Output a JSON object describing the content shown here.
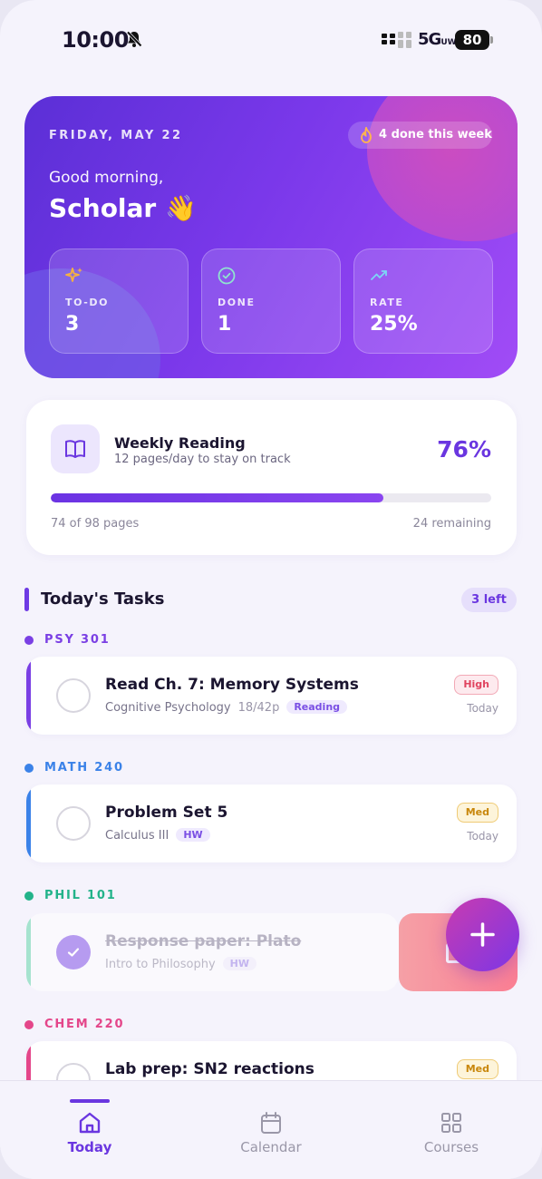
{
  "status": {
    "time": "10:00",
    "network": "5G",
    "network_sup": "UW",
    "battery": "80"
  },
  "hero": {
    "date": "FRIDAY, MAY 22",
    "streak": "4 done this week",
    "greeting": "Good morning,",
    "name": "Scholar 👋",
    "stats": [
      {
        "label": "TO-DO",
        "value": "3",
        "icon": "sparkles-icon",
        "color": "#f6b23e"
      },
      {
        "label": "DONE",
        "value": "1",
        "icon": "check-circle-icon",
        "color": "#8fe3cf"
      },
      {
        "label": "RATE",
        "value": "25%",
        "icon": "trending-up-icon",
        "color": "#7cd6f5"
      }
    ]
  },
  "reading": {
    "title": "Weekly Reading",
    "subtitle": "12 pages/day to stay on track",
    "percent": "76%",
    "progress": 0.755,
    "pages": "74 of 98 pages",
    "remaining": "24 remaining"
  },
  "tasks": {
    "title": "Today's Tasks",
    "left_badge": "3 left",
    "groups": [
      {
        "course": "PSY 301",
        "color": "#7a3fe4",
        "title": "Read Ch. 7: Memory Systems",
        "subject": "Cognitive Psychology",
        "pages": "18/42p",
        "tag": "Reading",
        "priority": "High",
        "due": "Today",
        "done": false
      },
      {
        "course": "MATH 240",
        "color": "#3b82e8",
        "title": "Problem Set 5",
        "subject": "Calculus III",
        "tag": "HW",
        "priority": "Med",
        "due": "Today",
        "done": false
      },
      {
        "course": "PHIL 101",
        "color": "#23b38a",
        "title": "Response paper: Plato",
        "subject": "Intro to Philosophy",
        "tag": "HW",
        "done": true
      },
      {
        "course": "CHEM 220",
        "color": "#e4468a",
        "title": "Lab prep: SN2 reactions",
        "priority": "Med",
        "done": false
      }
    ]
  },
  "nav": [
    {
      "label": "Today",
      "icon": "home-icon",
      "active": true
    },
    {
      "label": "Calendar",
      "icon": "calendar-icon",
      "active": false
    },
    {
      "label": "Courses",
      "icon": "grid-icon",
      "active": false
    }
  ],
  "colors": {
    "accent": "#6a36e0",
    "background": "#f5f3fc"
  }
}
